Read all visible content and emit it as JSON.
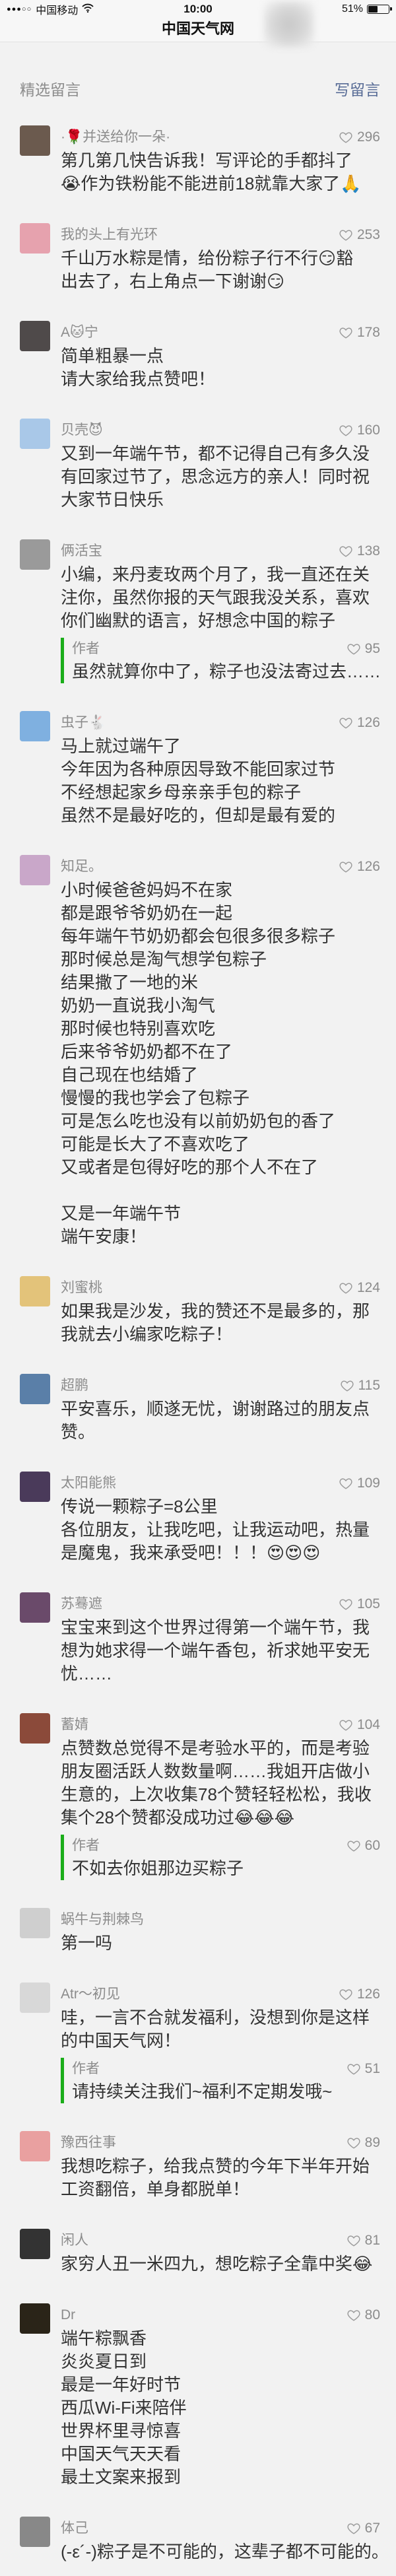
{
  "status_bar": {
    "signal": "●●●○○",
    "carrier": "中国移动",
    "time": "10:00",
    "battery": "51%"
  },
  "nav": {
    "title": "中国天气网"
  },
  "section": {
    "title": "精选留言",
    "write_label": "写留言"
  },
  "icons": {
    "like": "heart-outline-icon",
    "wifi": "wifi-icon",
    "battery": "battery-icon"
  },
  "colors": {
    "page_bg": "#f2f2f2",
    "header_bg": "#f7f7f7",
    "meta_text": "#8c8c8c",
    "body_text": "#333333",
    "link": "#576b95",
    "reply_bar": "#1aad19",
    "heart": "#9b9b9b"
  },
  "comments": [
    {
      "name": "·🌹并送给你一朵·",
      "likes": "296",
      "avatar_color": "#6b5a4e",
      "lines": [
        "第几第几快告诉我！写评论的手都抖了",
        "😭作为铁粉能不能进前18就靠大家了🙏"
      ]
    },
    {
      "name": "我的头上有光环",
      "likes": "253",
      "avatar_color": "#e6a2ae",
      "lines": [
        "千山万水粽是情，给份粽子行不行😏豁",
        "出去了，右上角点一下谢谢😏"
      ]
    },
    {
      "name": "A🐱宁",
      "likes": "178",
      "avatar_color": "#4f4a4a",
      "lines": [
        "简单粗暴一点",
        "请大家给我点赞吧！"
      ]
    },
    {
      "name": "贝壳😈",
      "likes": "160",
      "avatar_color": "#a9c8e8",
      "lines": [
        "又到一年端午节，都不记得自己有多久没",
        "有回家过节了，思念远方的亲人！同时祝",
        "大家节日快乐"
      ]
    },
    {
      "name": "俩活宝",
      "likes": "138",
      "avatar_color": "#9a9a9a",
      "lines": [
        "小编，来丹麦玫两个月了，我一直还在关",
        "注你，虽然你报的天气跟我没关系，喜欢",
        "你们幽默的语言，好想念中国的粽子"
      ],
      "reply": {
        "label": "作者",
        "likes": "95",
        "lines": [
          "虽然就算你中了，粽子也没法寄过去……"
        ]
      }
    },
    {
      "name": "虫子🐇",
      "likes": "126",
      "avatar_color": "#7fb0e0",
      "lines": [
        "马上就过端午了",
        "今年因为各种原因导致不能回家过节",
        "不经想起家乡母亲亲手包的粽子",
        "虽然不是最好吃的，但却是最有爱的"
      ]
    },
    {
      "name": "知足。",
      "likes": "126",
      "avatar_color": "#c9a7c9",
      "lines": [
        "小时候爸爸妈妈不在家",
        "都是跟爷爷奶奶在一起",
        "每年端午节奶奶都会包很多很多粽子",
        "那时候总是淘气想学包粽子",
        "结果撒了一地的米",
        "奶奶一直说我小淘气",
        "那时候也特别喜欢吃",
        "后来爷爷奶奶都不在了",
        "自己现在也结婚了",
        "慢慢的我也学会了包粽子",
        "可是怎么吃也没有以前奶奶包的香了",
        "可能是长大了不喜欢吃了",
        "又或者是包得好吃的那个人不在了",
        "",
        "又是一年端午节",
        "端午安康！"
      ]
    },
    {
      "name": "刘蜜桃",
      "likes": "124",
      "avatar_color": "#e3c37a",
      "lines": [
        "如果我是沙发，我的赞还不是最多的，那",
        "我就去小编家吃粽子！"
      ]
    },
    {
      "name": "超鹏",
      "likes": "115",
      "avatar_color": "#5a7fa8",
      "lines": [
        "平安喜乐，顺遂无忧，谢谢路过的朋友点",
        "赞。"
      ]
    },
    {
      "name": "太阳能熊",
      "likes": "109",
      "avatar_color": "#4a3a5a",
      "lines": [
        "传说一颗粽子=8公里",
        "各位朋友，让我吃吧，让我运动吧，热量",
        "是魔鬼，我来承受吧！！！😍😍😍"
      ]
    },
    {
      "name": "苏蓦遮",
      "likes": "105",
      "avatar_color": "#6a4a6a",
      "lines": [
        "宝宝来到这个世界过得第一个端午节，我",
        "想为她求得一个端午香包，祈求她平安无",
        "忧……"
      ]
    },
    {
      "name": "蓄婧",
      "likes": "104",
      "avatar_color": "#8b4a3a",
      "lines": [
        "点赞数总觉得不是考验水平的，而是考验",
        "朋友圈活跃人数数量啊……我姐开店做小",
        "生意的，上次收集78个赞轻轻松松，我收",
        "集个28个赞都没成功过😂😂😂"
      ],
      "reply": {
        "label": "作者",
        "likes": "60",
        "lines": [
          "不如去你姐那边买粽子"
        ]
      }
    },
    {
      "name": "蜗牛与荆棘鸟",
      "avatar_color": "#cfcfcf",
      "lines": [
        "第一吗"
      ]
    },
    {
      "name": "Atr～初见",
      "likes": "126",
      "avatar_color": "#d8d8d8",
      "lines": [
        "哇，一言不合就发福利，没想到你是这样",
        "的中国天气网！"
      ],
      "reply": {
        "label": "作者",
        "likes": "51",
        "lines": [
          "请持续关注我们~福利不定期发哦~"
        ]
      }
    },
    {
      "name": "豫西往事",
      "likes": "89",
      "avatar_color": "#e9a0a0",
      "lines": [
        "我想吃粽子，给我点赞的今年下半年开始",
        "工资翻倍，单身都脱单！"
      ]
    },
    {
      "name": "闲人",
      "likes": "81",
      "avatar_color": "#333333",
      "lines": [
        "家穷人丑一米四九，想吃粽子全靠中奖😂"
      ]
    },
    {
      "name": "Dr",
      "likes": "80",
      "avatar_color": "#2a2418",
      "lines": [
        "端午粽飘香",
        "炎炎夏日到",
        "最是一年好时节",
        "西瓜Wi-Fi来陪伴",
        "世界杯里寻惊喜",
        "中国天气天天看",
        "最土文案来报到"
      ]
    },
    {
      "name": "体己",
      "likes": "67",
      "avatar_color": "#888888",
      "lines": [
        "(-ε´-)粽子是不可能的，这辈子都不可能的。"
      ]
    }
  ]
}
